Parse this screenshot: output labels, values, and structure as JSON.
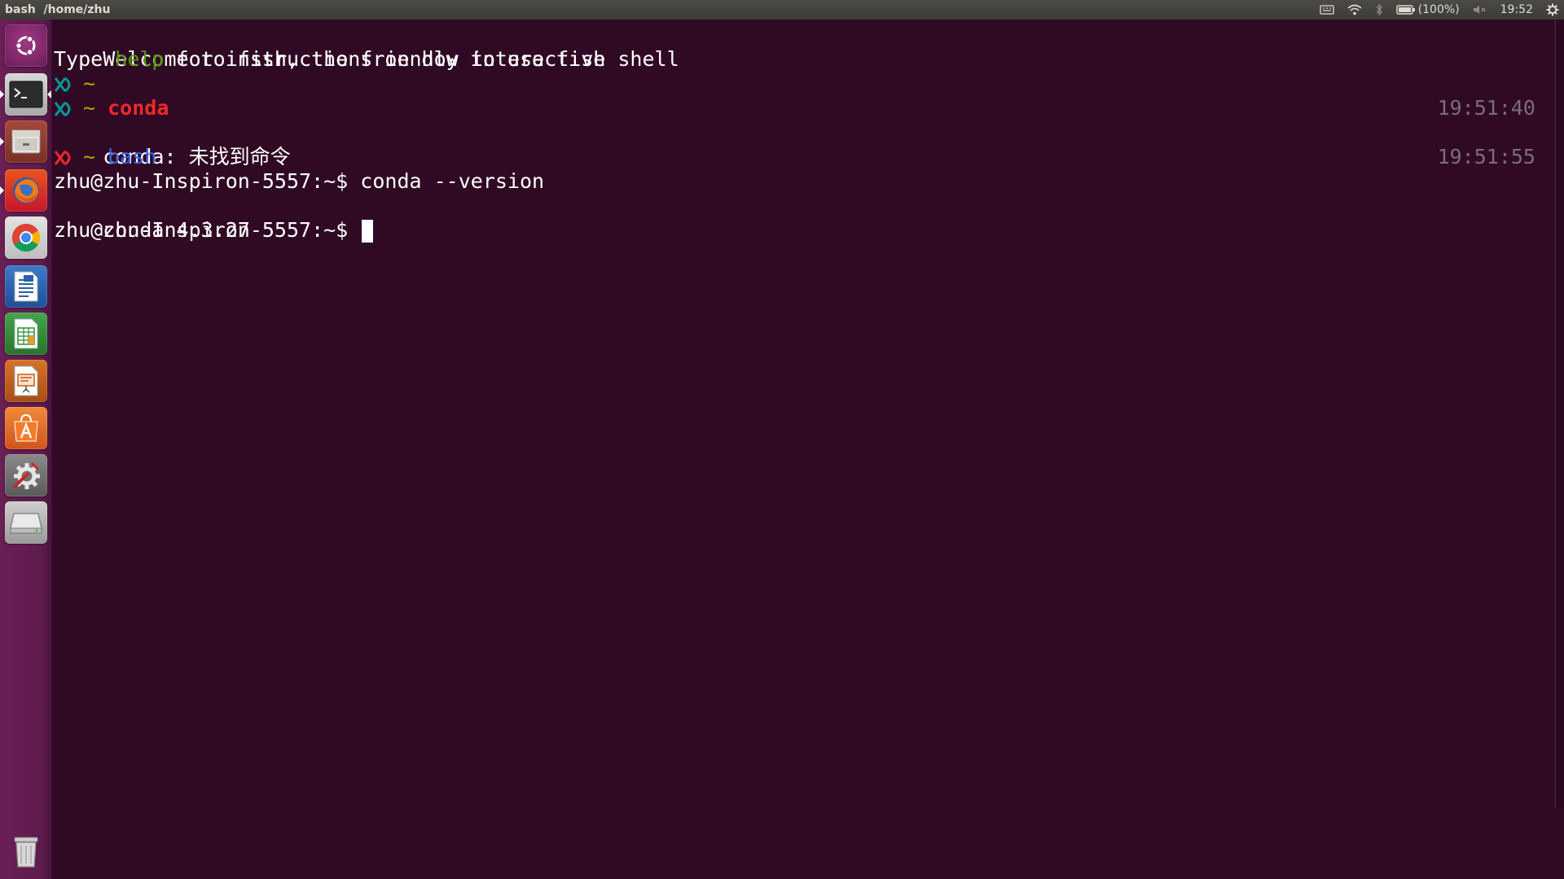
{
  "top_panel": {
    "title": "bash  /home/zhu",
    "battery": "(100%)",
    "time": "19:52",
    "icons": [
      "keyboard-icon",
      "wifi-icon",
      "bluetooth-icon",
      "battery-icon",
      "volume-muted-icon",
      "settings-gear-icon"
    ]
  },
  "launcher": {
    "items": [
      {
        "name": "Ubuntu Dash",
        "icon": "ubuntu-logo-icon"
      },
      {
        "name": "Terminal",
        "icon": "terminal-icon",
        "active": true
      },
      {
        "name": "Files",
        "icon": "files-icon"
      },
      {
        "name": "Firefox",
        "icon": "firefox-icon"
      },
      {
        "name": "Chrome",
        "icon": "chrome-icon"
      },
      {
        "name": "LibreOffice Writer",
        "icon": "writer-icon"
      },
      {
        "name": "LibreOffice Calc",
        "icon": "calc-icon"
      },
      {
        "name": "LibreOffice Impress",
        "icon": "impress-icon"
      },
      {
        "name": "Ubuntu Software",
        "icon": "software-center-icon"
      },
      {
        "name": "System Settings",
        "icon": "system-settings-icon"
      },
      {
        "name": "Disk",
        "icon": "disk-icon"
      },
      {
        "name": "Trash",
        "icon": "trash-icon"
      }
    ]
  },
  "terminal": {
    "colors": {
      "background": "#300a24",
      "text": "#ffffff",
      "green": "#4e9a06",
      "teal": "#06989a",
      "red": "#ef2929",
      "blue": "#3465e6",
      "yellow": "#c4a000",
      "timestamp": "#7a6e76"
    },
    "welcome": {
      "line1": "Welcome to fish, the friendly interactive shell",
      "line2_pre": "Type ",
      "line2_help": "help",
      "line2_post": " for instructions on how to use fish"
    },
    "prompt_tilde": "~",
    "cmd_conda": "conda",
    "ts_conda": "19:51:40",
    "conda_error": "conda: 未找到命令",
    "cmd_bash": "bash",
    "ts_bash": "19:51:55",
    "bash_prompt": "zhu@zhu-Inspiron-5557:~$ ",
    "bash_cmd": "conda --version",
    "conda_version_output": "conda 4.3.27",
    "bash_prompt2": "zhu@zhu-Inspiron-5557:~$ "
  }
}
